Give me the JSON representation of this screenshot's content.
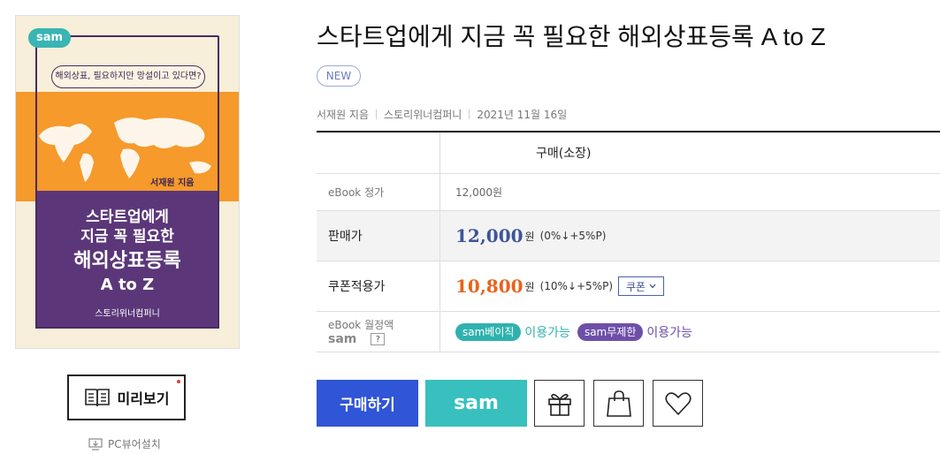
{
  "cover": {
    "sam_badge": "sam",
    "ribbon": "해외상표, 필요하지만 망설이고 있다면?",
    "author": "서재원 지음",
    "title_line1": "스타트업에게",
    "title_line2": "지금 꼭 필요한",
    "title_line3": "해외상표등록",
    "title_line4": "A to Z",
    "publisher": "스토리위너컴퍼니"
  },
  "preview": {
    "label": "미리보기"
  },
  "pcviewer": {
    "label": "PC뷰어설치"
  },
  "book": {
    "title": "스타트업에게 지금 꼭 필요한 해외상표등록 A to Z",
    "badge": "NEW",
    "author": "서재원 지음",
    "publisher": "스토리위너컴퍼니",
    "date": "2021년 11월 16일"
  },
  "price_table": {
    "column_header": "구매(소장)",
    "ebook_price_label": "eBook 정가",
    "ebook_price": "12,000원",
    "sale_label": "판매가",
    "sale_price": "12,000",
    "sale_won": "원",
    "sale_rate": "(0%↓+5%P)",
    "coupon_label": "쿠폰적용가",
    "coupon_price": "10,800",
    "coupon_won": "원",
    "coupon_rate": "(10%↓+5%P)",
    "coupon_button": "쿠폰",
    "monthly_label": "eBook 월정액",
    "monthly_sub": "sam",
    "monthly_help": "?",
    "plans": [
      {
        "name": "sam베이직",
        "status": "이용가능",
        "color": "#2fb2af"
      },
      {
        "name": "sam무제한",
        "status": "이용가능",
        "color": "#6e4fa8"
      }
    ]
  },
  "actions": {
    "buy_label": "구매하기",
    "sam_label": "sam"
  },
  "colors": {
    "buy": "#3055d6",
    "sam": "#37c0bd",
    "sale_price": "#3e5497",
    "coupon_price": "#e8631c"
  }
}
